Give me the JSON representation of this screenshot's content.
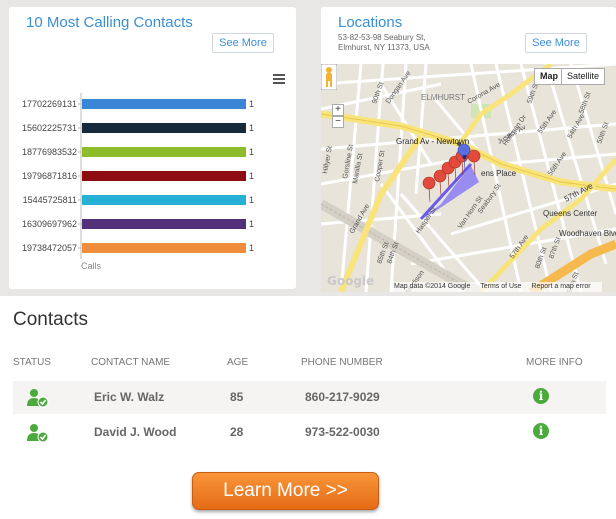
{
  "calls_panel": {
    "title": "10 Most Calling Contacts",
    "see_more_label": "See More",
    "menu_icon": "hamburger-menu-icon"
  },
  "chart_data": {
    "type": "bar",
    "orientation": "horizontal",
    "categories": [
      "17702269131",
      "15602225731",
      "18776983532",
      "19796871816",
      "15445725811",
      "16309697962",
      "19738472057"
    ],
    "values": [
      1,
      1,
      1,
      1,
      1,
      1,
      1
    ],
    "bar_colors": [
      "#3a85d4",
      "#172a3d",
      "#8cbc2a",
      "#8e0d10",
      "#27b0d6",
      "#54307a",
      "#f08d3c"
    ],
    "xlabel": "Calls",
    "value_labels": [
      "1",
      "1",
      "1",
      "1",
      "1",
      "1",
      "1"
    ],
    "grid": false
  },
  "locations_panel": {
    "title": "Locations",
    "see_more_label": "See More",
    "address_line1": "53-82-53-98 Seabury St,",
    "address_line2": "Elmhurst, NY 11373, USA",
    "map": {
      "type_map_label": "Map",
      "type_satellite_label": "Satellite",
      "zoom_in_label": "+",
      "zoom_out_label": "−",
      "logo_text": "Google",
      "footer_data": "Map data ©2014 Google",
      "footer_terms": "Terms of Use",
      "footer_report": "Report a map error",
      "labels": {
        "elmhurst": "ELMHURST",
        "grand_av": "Grand Av - Newtown",
        "queens_place": "ens Place",
        "queens_center": "Queens Center",
        "woodhaven": "Woodhaven Blvd",
        "ave57": "57th Ave",
        "ave56": "56th Ave",
        "justice_av": "Justice Av",
        "grand_ave": "Grand Ave",
        "hoffman_dr": "Hoffman Dr",
        "seabury_st": "Seabury St",
        "van_horn": "Van Horn St",
        "haspel_st": "Haspel St",
        "madison": "Madison",
        "hillyer": "Hillyer St",
        "gorsline": "Gorsline St",
        "manilla": "Manilla St",
        "cooper": "Cooper St",
        "dongan": "Dongan Ave",
        "corona": "Corona Ave",
        "st57": "57th St",
        "st84": "84th St",
        "st85": "85th St",
        "st90": "90th St",
        "st58": "58th St",
        "st59": "59th St",
        "st50": "50th St",
        "st54": "54th Ave",
        "ave57b": "57th Ave",
        "ave80": "80th St",
        "st87": "87th St",
        "ave55": "55th Ave"
      },
      "marker_color": "#e24b3b",
      "route_color": "#7a6cf0"
    }
  },
  "contacts": {
    "title": "Contacts",
    "columns": [
      "STATUS",
      "CONTACT NAME",
      "AGE",
      "PHONE NUMBER",
      "MORE INFO"
    ],
    "rows": [
      {
        "name": "Eric W. Walz",
        "age": "85",
        "phone": "860-217-9029",
        "status_icon": "user-check-icon",
        "info_icon": "info-icon"
      },
      {
        "name": "David J. Wood",
        "age": "28",
        "phone": "973-522-0030",
        "status_icon": "user-check-icon",
        "info_icon": "info-icon"
      }
    ]
  },
  "cta": {
    "learn_more_label": "Learn More >>"
  },
  "colors": {
    "accent": "#3a8fd6",
    "cta_orange": "#f08a2e",
    "status_green": "#4aab3c"
  }
}
